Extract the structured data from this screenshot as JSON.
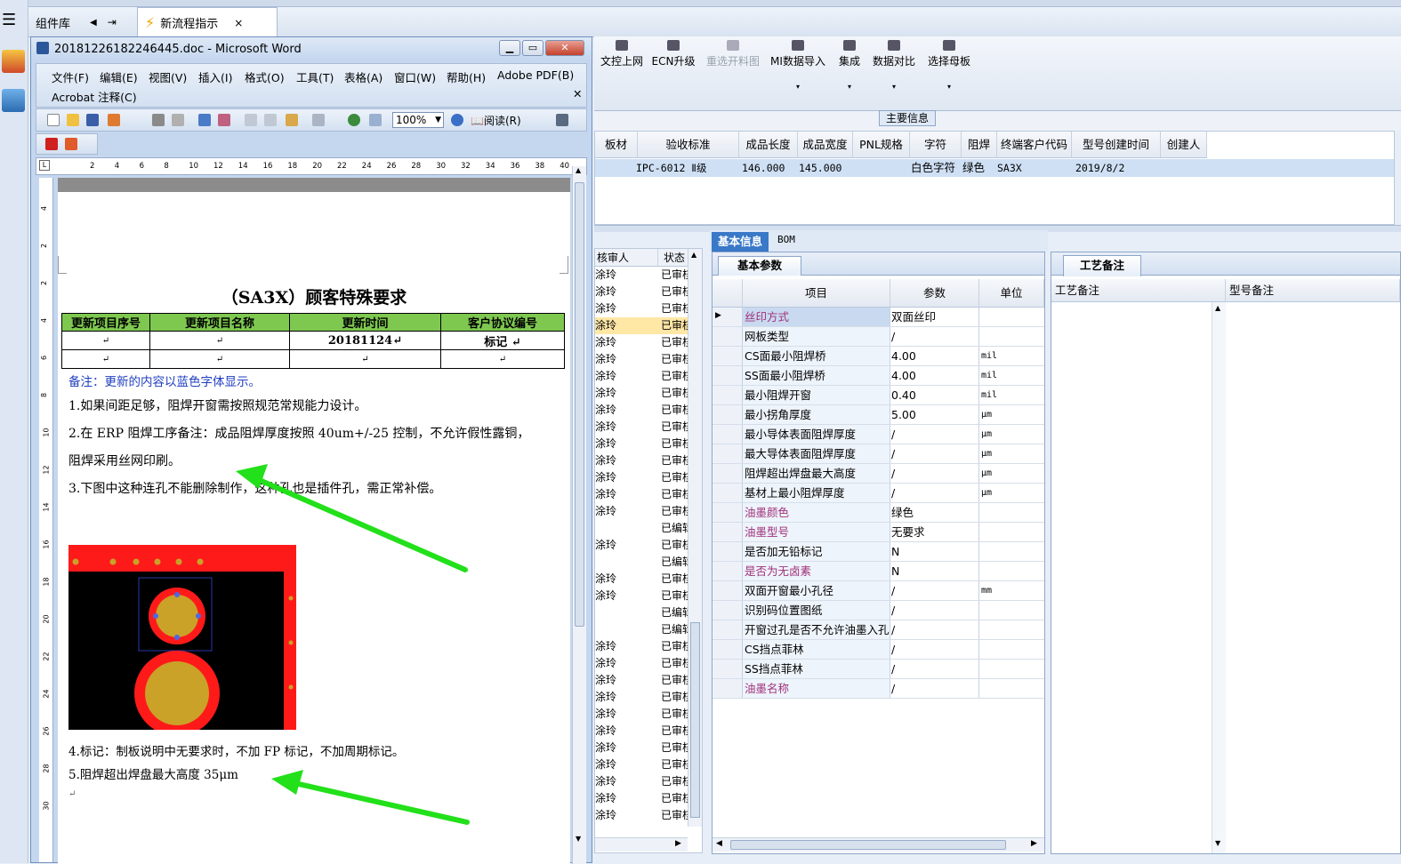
{
  "tabs": {
    "library": "组件库",
    "active": "新流程指示"
  },
  "word": {
    "title": "20181226182246445.doc - Microsoft Word",
    "menu": [
      "文件(F)",
      "编辑(E)",
      "视图(V)",
      "插入(I)",
      "格式(O)",
      "工具(T)",
      "表格(A)",
      "窗口(W)",
      "帮助(H)",
      "Adobe PDF(B)"
    ],
    "menu2": "Acrobat 注释(C)",
    "zoom": "100%",
    "read_label": "阅读(R)",
    "ruler_ticks": [
      "2",
      "4",
      "6",
      "8",
      "10",
      "12",
      "14",
      "16",
      "18",
      "20",
      "22",
      "24",
      "26",
      "28",
      "30",
      "32",
      "34",
      "36",
      "38",
      "40"
    ],
    "vruler_ticks": [
      "4",
      "2",
      "2",
      "4",
      "6",
      "8",
      "10",
      "12",
      "14",
      "16",
      "18",
      "20",
      "22",
      "24",
      "26",
      "28",
      "30"
    ],
    "doc": {
      "title": "（SA3X）顾客特殊要求",
      "table_headers": [
        "更新项目序号",
        "更新项目名称",
        "更新时间",
        "客户协议编号"
      ],
      "table_rows": [
        [
          "↵",
          "↵",
          "20181124↵",
          "标记 ↵"
        ],
        [
          "↵",
          "↵",
          "↵",
          "↵"
        ]
      ],
      "note": "备注：更新的内容以蓝色字体显示。",
      "line1": "1.如果间距足够，阻焊开窗需按照规范常规能力设计。",
      "line2a": "2.在 ERP 阻焊工序备注：成品阻焊厚度按照 40um+/-25 控制，不允许假性露铜，",
      "line2b": "阻焊采用丝网印刷。",
      "line3": "3.下图中这种连孔不能删除制作，这种孔也是插件孔，需正常补偿。",
      "line4": "4.标记：制板说明中无要求时，不加 FP 标记，不加周期标记。",
      "line5": "5.阻焊超出焊盘最大高度 35μm",
      "pilcrow": "↵"
    }
  },
  "toolbar": [
    {
      "label": "文控上网",
      "dd": ""
    },
    {
      "label": "ECN升级",
      "dd": ""
    },
    {
      "label": "重选开料图",
      "dd": ""
    },
    {
      "label": "MI数据导入",
      "dd": "▾"
    },
    {
      "label": "集成",
      "dd": "▾"
    },
    {
      "label": "数据对比",
      "dd": "▾"
    },
    {
      "label": "选择母板",
      "dd": "▾"
    }
  ],
  "main_info": {
    "badge": "主要信息",
    "headers": [
      "板材",
      "验收标准",
      "成品长度",
      "成品宽度",
      "PNL规格",
      "字符",
      "阻焊",
      "终端客户代码",
      "型号创建时间",
      "创建人"
    ],
    "row": [
      "",
      "IPC-6012 Ⅱ级",
      "146.000",
      "145.000",
      "",
      "白色字符",
      "绿色",
      "SA3X",
      "2019/8/2",
      ""
    ]
  },
  "list": {
    "headers": [
      "核审人",
      "状态"
    ],
    "rows": [
      [
        "涂玲",
        "已审核"
      ],
      [
        "涂玲",
        "已审核"
      ],
      [
        "涂玲",
        "已审核"
      ],
      [
        "涂玲",
        "已审核"
      ],
      [
        "涂玲",
        "已审核"
      ],
      [
        "涂玲",
        "已审核"
      ],
      [
        "涂玲",
        "已审核"
      ],
      [
        "涂玲",
        "已审核"
      ],
      [
        "涂玲",
        "已审核"
      ],
      [
        "涂玲",
        "已审核"
      ],
      [
        "涂玲",
        "已审核"
      ],
      [
        "涂玲",
        "已审核"
      ],
      [
        "涂玲",
        "已审核"
      ],
      [
        "涂玲",
        "已审核"
      ],
      [
        "涂玲",
        "已审核"
      ],
      [
        "",
        "已编辑"
      ],
      [
        "涂玲",
        "已审核"
      ],
      [
        "",
        "已编辑"
      ],
      [
        "涂玲",
        "已审核"
      ],
      [
        "涂玲",
        "已审核"
      ],
      [
        "",
        "已编辑"
      ],
      [
        "",
        "已编辑"
      ],
      [
        "涂玲",
        "已审核"
      ],
      [
        "涂玲",
        "已审核"
      ],
      [
        "涂玲",
        "已审核"
      ],
      [
        "涂玲",
        "已审核"
      ],
      [
        "涂玲",
        "已审核"
      ],
      [
        "涂玲",
        "已审核"
      ],
      [
        "涂玲",
        "已审核"
      ],
      [
        "涂玲",
        "已审核"
      ],
      [
        "涂玲",
        "已审核"
      ],
      [
        "涂玲",
        "已审核"
      ],
      [
        "涂玲",
        "已审核"
      ]
    ]
  },
  "detail": {
    "tabs": [
      "基本信息",
      "BOM"
    ],
    "subtab": "基本参数",
    "headers": [
      "项目",
      "参数",
      "单位"
    ],
    "rows": [
      {
        "item": "丝印方式",
        "value": "双面丝印",
        "unit": "",
        "pink": true
      },
      {
        "item": "网板类型",
        "value": "/",
        "unit": "",
        "pink": false
      },
      {
        "item": "CS面最小阻焊桥",
        "value": "4.00",
        "unit": "mil",
        "pink": false
      },
      {
        "item": "SS面最小阻焊桥",
        "value": "4.00",
        "unit": "mil",
        "pink": false
      },
      {
        "item": "最小阻焊开窗",
        "value": "0.40",
        "unit": "mil",
        "pink": false
      },
      {
        "item": "最小拐角厚度",
        "value": "5.00",
        "unit": "μm",
        "pink": false
      },
      {
        "item": "最小导体表面阻焊厚度",
        "value": "/",
        "unit": "μm",
        "pink": false
      },
      {
        "item": "最大导体表面阻焊厚度",
        "value": "/",
        "unit": "μm",
        "pink": false
      },
      {
        "item": "阻焊超出焊盘最大高度",
        "value": "/",
        "unit": "μm",
        "pink": false
      },
      {
        "item": "基材上最小阻焊厚度",
        "value": "/",
        "unit": "μm",
        "pink": false
      },
      {
        "item": "油墨颜色",
        "value": "绿色",
        "unit": "",
        "pink": true
      },
      {
        "item": "油墨型号",
        "value": "无要求",
        "unit": "",
        "pink": true
      },
      {
        "item": "是否加无铅标记",
        "value": "N",
        "unit": "",
        "pink": false
      },
      {
        "item": "是否为无卤素",
        "value": "N",
        "unit": "",
        "pink": true
      },
      {
        "item": "双面开窗最小孔径",
        "value": "/",
        "unit": "mm",
        "pink": false
      },
      {
        "item": "识别码位置图纸",
        "value": "/",
        "unit": "",
        "pink": false
      },
      {
        "item": "开窗过孔是否不允许油墨入孔",
        "value": "/",
        "unit": "",
        "pink": false
      },
      {
        "item": "CS挡点菲林",
        "value": "/",
        "unit": "",
        "pink": false
      },
      {
        "item": "SS挡点菲林",
        "value": "/",
        "unit": "",
        "pink": false
      },
      {
        "item": "油墨名称",
        "value": "/",
        "unit": "",
        "pink": true
      }
    ]
  },
  "process": {
    "tab": "工艺备注",
    "headers": [
      "工艺备注",
      "型号备注"
    ]
  },
  "colors": {
    "arrow": "#22e01a",
    "pcb_red": "#ff1a1a",
    "pad_gold": "#c9a227",
    "table_green": "#7ec850",
    "note_blue": "#1f3fbf",
    "pink_label": "#a0307a"
  }
}
